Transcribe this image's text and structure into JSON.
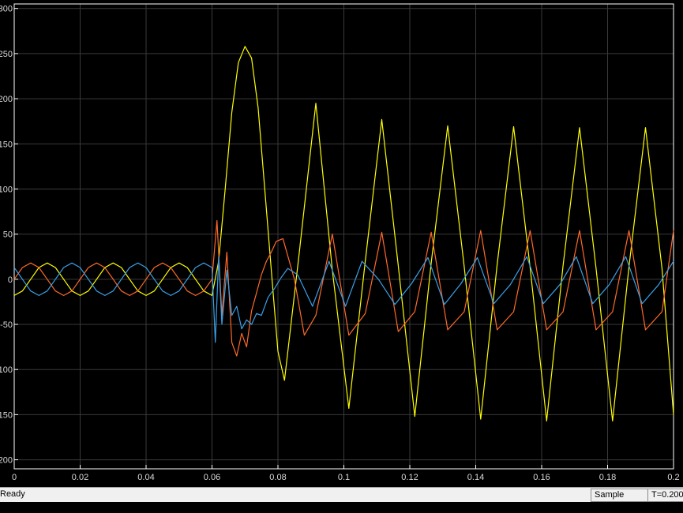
{
  "status": {
    "ready": "Ready",
    "mode": "Sample based",
    "time": "T=0.200"
  },
  "colors": {
    "background": "#000000",
    "axes": "#ffffff",
    "grid": "#3a3a3a",
    "tick_text": "#d9d9d9",
    "status_bar": "#f0f0f0"
  },
  "chart_data": {
    "type": "line",
    "title": "",
    "xlabel": "",
    "ylabel": "",
    "xlim": [
      0,
      0.2
    ],
    "ylim": [
      -210,
      305
    ],
    "x_ticks": [
      0,
      0.02,
      0.04,
      0.06,
      0.08,
      0.1,
      0.12,
      0.14,
      0.16,
      0.18,
      0.2
    ],
    "x_tick_labels": [
      "0",
      "0.02",
      "0.04",
      "0.06",
      "0.08",
      "0.1",
      "0.12",
      "0.14",
      "0.16",
      "0.18",
      "0.2"
    ],
    "y_ticks": [
      -200,
      -150,
      -100,
      -50,
      0,
      50,
      100,
      150,
      200,
      250,
      300
    ],
    "y_tick_labels": [
      "-200",
      "-150",
      "-100",
      "-50",
      "0",
      "50",
      "100",
      "150",
      "200",
      "250",
      "300"
    ],
    "grid": true,
    "series": [
      {
        "color": "#ffff00",
        "x": [
          0,
          0.0025,
          0.005,
          0.0075,
          0.01,
          0.0125,
          0.015,
          0.0175,
          0.02,
          0.0225,
          0.025,
          0.0275,
          0.03,
          0.0325,
          0.035,
          0.0375,
          0.04,
          0.0425,
          0.045,
          0.0475,
          0.05,
          0.0525,
          0.055,
          0.0575,
          0.06,
          0.062,
          0.064,
          0.066,
          0.068,
          0.07,
          0.072,
          0.074,
          0.076,
          0.078,
          0.08,
          0.082,
          0.0865,
          0.0915,
          0.0965,
          0.1015,
          0.1065,
          0.1115,
          0.1165,
          0.1215,
          0.1265,
          0.1315,
          0.1365,
          0.1415,
          0.1465,
          0.1515,
          0.1565,
          0.1615,
          0.1665,
          0.1715,
          0.1765,
          0.1815,
          0.1865,
          0.1915,
          0.1965,
          0.2
        ],
        "y": [
          -18,
          -13,
          0,
          13,
          18,
          13,
          0,
          -13,
          -18,
          -13,
          0,
          13,
          18,
          13,
          0,
          -13,
          -18,
          -13,
          0,
          13,
          18,
          13,
          0,
          -13,
          -18,
          20,
          100,
          185,
          240,
          258,
          245,
          190,
          100,
          10,
          -80,
          -112,
          30,
          195,
          10,
          -143,
          20,
          177,
          15,
          -152,
          18,
          170,
          14,
          -155,
          16,
          169,
          13,
          -157,
          15,
          168,
          12,
          -157,
          14,
          168,
          12,
          -150
        ]
      },
      {
        "color": "#ff6a2a",
        "x": [
          0,
          0.0025,
          0.005,
          0.0075,
          0.01,
          0.0125,
          0.015,
          0.0175,
          0.02,
          0.0225,
          0.025,
          0.0275,
          0.03,
          0.0325,
          0.035,
          0.0375,
          0.04,
          0.0425,
          0.045,
          0.0475,
          0.05,
          0.0525,
          0.055,
          0.0575,
          0.06,
          0.0615,
          0.063,
          0.0645,
          0.066,
          0.0675,
          0.069,
          0.0705,
          0.072,
          0.0735,
          0.075,
          0.0765,
          0.078,
          0.0795,
          0.0815,
          0.085,
          0.088,
          0.0915,
          0.0965,
          0.1015,
          0.1065,
          0.1115,
          0.1165,
          0.1215,
          0.1265,
          0.1315,
          0.1365,
          0.1415,
          0.1465,
          0.1515,
          0.1565,
          0.1615,
          0.1665,
          0.1715,
          0.1765,
          0.1815,
          0.1865,
          0.1915,
          0.1965,
          0.2
        ],
        "y": [
          0,
          13,
          18,
          13,
          0,
          -13,
          -18,
          -13,
          0,
          13,
          18,
          13,
          0,
          -13,
          -18,
          -13,
          0,
          13,
          18,
          13,
          0,
          -13,
          -18,
          -13,
          0,
          65,
          -40,
          30,
          -70,
          -85,
          -60,
          -75,
          -35,
          -15,
          5,
          20,
          30,
          42,
          45,
          0,
          -62,
          -40,
          50,
          -62,
          -38,
          52,
          -58,
          -36,
          52,
          -56,
          -36,
          54,
          -56,
          -36,
          54,
          -56,
          -36,
          54,
          -56,
          -36,
          54,
          -56,
          -36,
          54
        ]
      },
      {
        "color": "#3aa0e8",
        "x": [
          0,
          0.0025,
          0.005,
          0.0075,
          0.01,
          0.0125,
          0.015,
          0.0175,
          0.02,
          0.0225,
          0.025,
          0.0275,
          0.03,
          0.0325,
          0.035,
          0.0375,
          0.04,
          0.0425,
          0.045,
          0.0475,
          0.05,
          0.0525,
          0.055,
          0.0575,
          0.06,
          0.061,
          0.062,
          0.063,
          0.0645,
          0.066,
          0.0675,
          0.069,
          0.0705,
          0.072,
          0.0735,
          0.075,
          0.077,
          0.079,
          0.081,
          0.083,
          0.086,
          0.0905,
          0.0955,
          0.1005,
          0.1055,
          0.1105,
          0.1155,
          0.1205,
          0.1255,
          0.1305,
          0.1355,
          0.1405,
          0.1455,
          0.1505,
          0.1555,
          0.1605,
          0.1655,
          0.1705,
          0.1755,
          0.1805,
          0.1855,
          0.1905,
          0.1955,
          0.2
        ],
        "y": [
          13,
          0,
          -13,
          -18,
          -13,
          0,
          13,
          18,
          13,
          0,
          -13,
          -18,
          -13,
          0,
          13,
          18,
          13,
          0,
          -13,
          -18,
          -13,
          0,
          13,
          18,
          13,
          -70,
          25,
          -50,
          10,
          -40,
          -30,
          -55,
          -45,
          -50,
          -38,
          -40,
          -20,
          -10,
          2,
          12,
          5,
          -30,
          20,
          -30,
          20,
          0,
          -28,
          -5,
          24,
          -28,
          -5,
          24,
          -27,
          -6,
          25,
          -27,
          -6,
          25,
          -27,
          -6,
          25,
          -27,
          -6,
          20
        ]
      }
    ]
  }
}
